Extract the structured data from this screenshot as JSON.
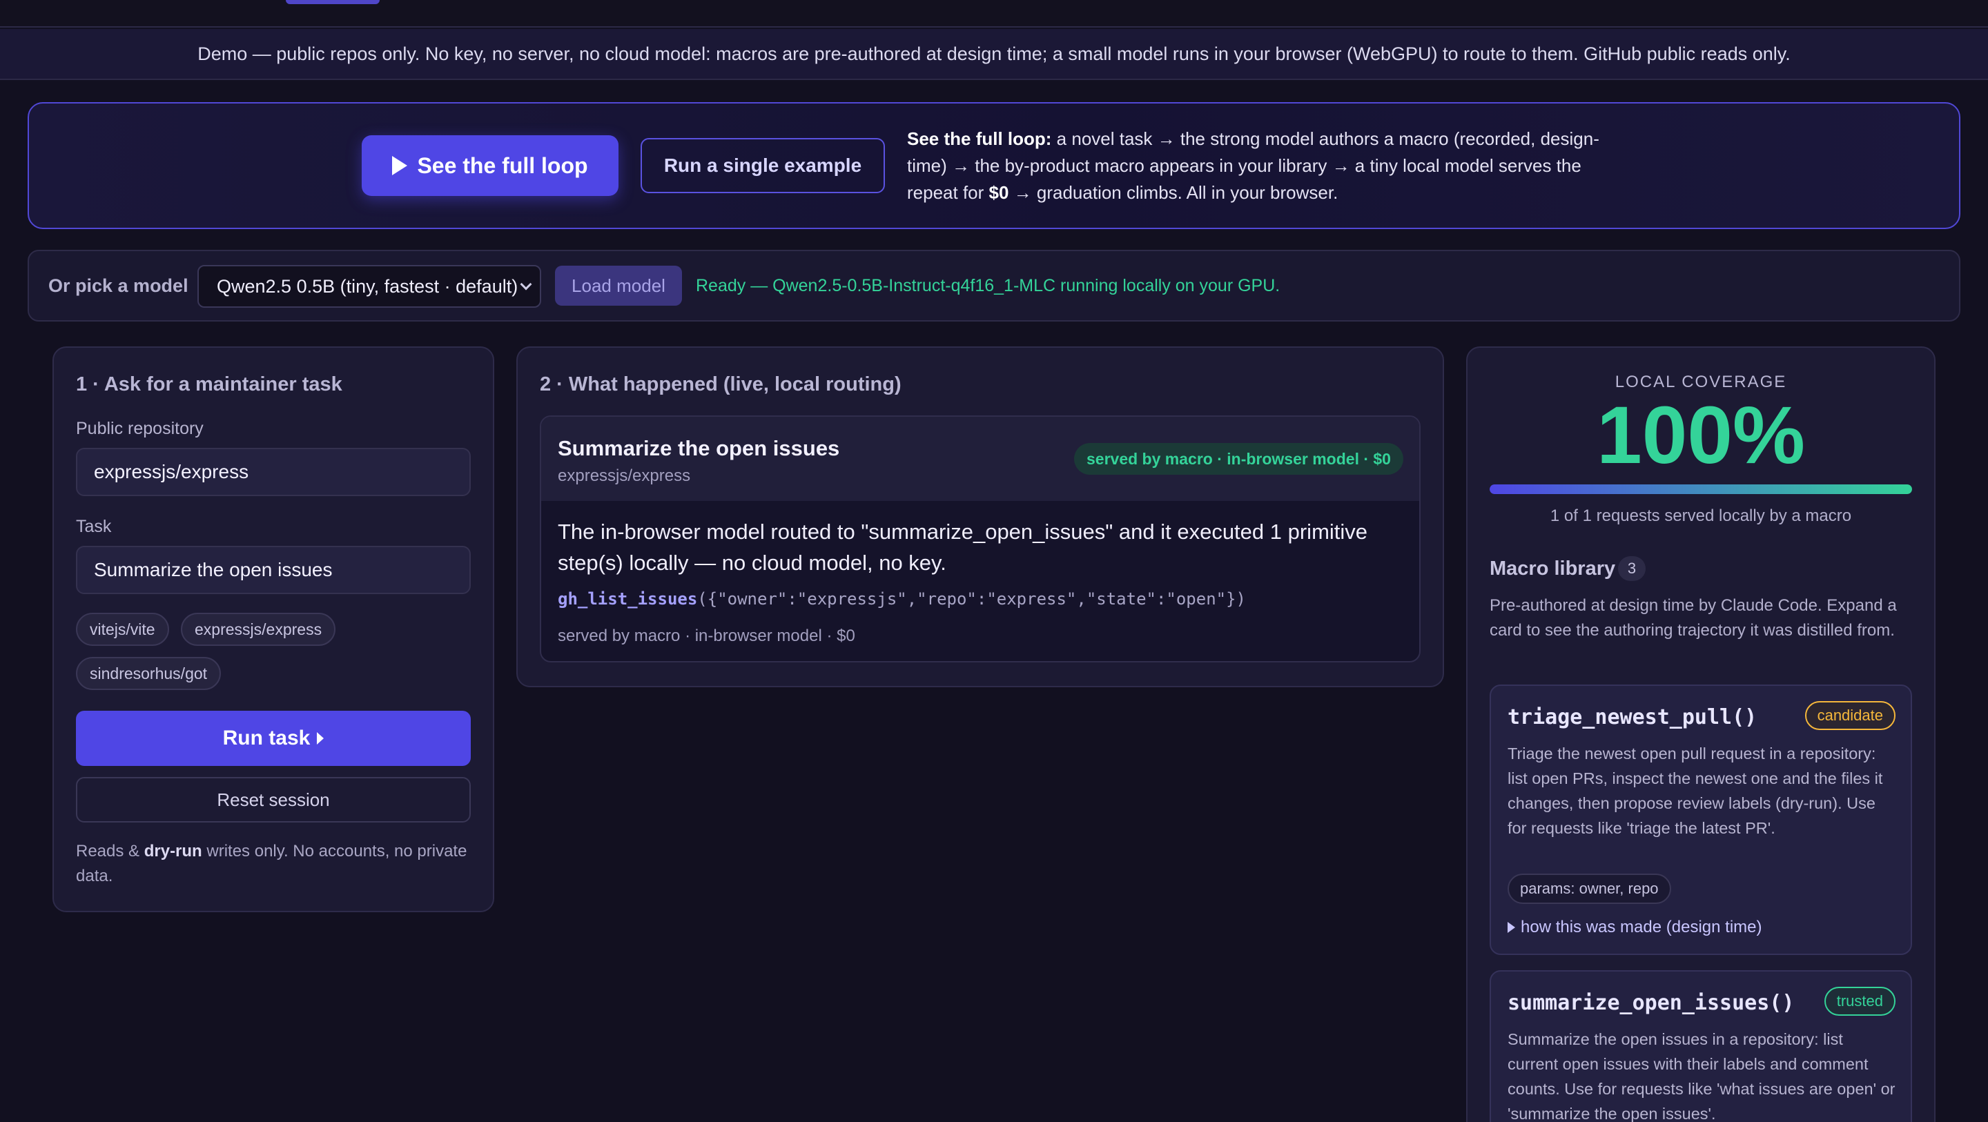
{
  "banner": {
    "text": "Demo — public repos only. No key, no server, no cloud model: macros are pre-authored at design time; a small model runs in your browser (WebGPU) to route to them. GitHub public reads only."
  },
  "hero": {
    "primary_button": "See the full loop",
    "secondary_button": "Run a single example",
    "desc_bold": "See the full loop:",
    "desc_part1": " a novel task → the strong model authors a macro (recorded, design-time) → the by-product macro appears in your library → a tiny local model serves the repeat for ",
    "desc_bold2": "$0",
    "desc_part2": " → graduation climbs. All in your browser."
  },
  "model_bar": {
    "label": "Or pick a model",
    "selected": "Qwen2.5 0.5B (tiny, fastest · default)",
    "load_button": "Load model",
    "status": "Ready — Qwen2.5-0.5B-Instruct-q4f16_1-MLC running locally on your GPU."
  },
  "ask_panel": {
    "title": "1 · Ask for a maintainer task",
    "repo_label": "Public repository",
    "repo_value": "expressjs/express",
    "task_label": "Task",
    "task_value": "Summarize the open issues",
    "chips": [
      "vitejs/vite",
      "expressjs/express",
      "sindresorhus/got"
    ],
    "run_button": "Run task",
    "reset_button": "Reset session",
    "note_prefix": "Reads & ",
    "note_bold": "dry-run",
    "note_suffix": " writes only. No accounts, no private data."
  },
  "result_panel": {
    "title": "2 · What happened (live, local routing)",
    "card_title": "Summarize the open issues",
    "card_repo": "expressjs/express",
    "badge": "served by macro · in-browser model · $0",
    "body": "The in-browser model routed to \"summarize_open_issues\" and it executed 1 primitive step(s) locally — no cloud model, no key.",
    "code_fn": "gh_list_issues",
    "code_args": "({\"owner\":\"expressjs\",\"repo\":\"express\",\"state\":\"open\"})",
    "footer": "served by macro · in-browser model · $0"
  },
  "coverage": {
    "label": "LOCAL COVERAGE",
    "value": "100%",
    "fraction": 1.0,
    "caption": "1 of 1 requests served locally by a macro"
  },
  "library": {
    "title": "Macro library",
    "count": "3",
    "desc": "Pre-authored at design time by Claude Code. Expand a card to see the authoring trajectory it was distilled from.",
    "macros": [
      {
        "name": "triage_newest_pull()",
        "status": "candidate",
        "desc": "Triage the newest open pull request in a repository: list open PRs, inspect the newest one and the files it changes, then propose review labels (dry-run). Use for requests like 'triage the latest PR'.",
        "params": "params: owner, repo",
        "how": "how this was made (design time)"
      },
      {
        "name": "summarize_open_issues()",
        "status": "trusted",
        "desc": "Summarize the open issues in a repository: list current open issues with their labels and comment counts. Use for requests like 'what issues are open' or 'summarize the open issues'."
      }
    ]
  },
  "colors": {
    "accent": "#4f46e5",
    "success": "#34d399",
    "warning": "#f5b73b",
    "background": "#121020"
  }
}
